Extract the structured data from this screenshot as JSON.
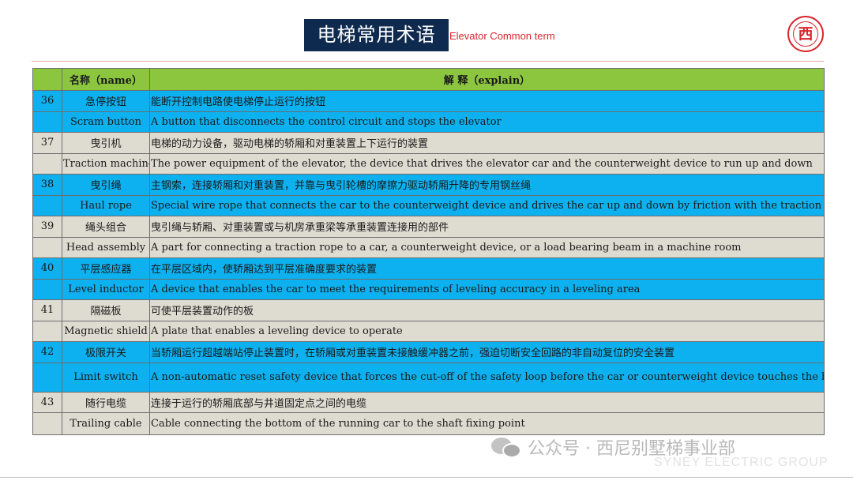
{
  "header": {
    "title": "电梯常用术语",
    "subtitle": "Elevator Common term",
    "logo_text": "西"
  },
  "colors": {
    "title_bg": "#0e2a4f",
    "accent_red": "#d9262c",
    "header_green": "#8cc63f",
    "row_blue": "#0db1ef",
    "row_grey": "#dedbd0"
  },
  "table": {
    "headers": {
      "name": "名称（name）",
      "explain": "解 释（explain）"
    },
    "rows": [
      {
        "num": "36",
        "name": "急停按钮",
        "explain": "能断开控制电路使电梯停止运行的按钮"
      },
      {
        "num": "",
        "name": "Scram button",
        "explain": "A button that disconnects the control circuit and stops the elevator"
      },
      {
        "num": "37",
        "name": "曳引机",
        "explain": "电梯的动力设备，驱动电梯的轿厢和对重装置上下运行的装置"
      },
      {
        "num": "",
        "name": "Traction machine",
        "explain": "The power equipment of the elevator, the device that drives the elevator car and the counterweight device to run up and down"
      },
      {
        "num": "38",
        "name": "曳引绳",
        "explain": "主钢索，连接轿厢和对重装置，并靠与曳引轮槽的摩擦力驱动轿厢升降的专用钢丝绳"
      },
      {
        "num": "",
        "name": "Haul rope",
        "explain": "Special wire rope that connects the car to the counterweight device and drives the car up and down by friction with the traction wheel groove"
      },
      {
        "num": "39",
        "name": "绳头组合",
        "explain": "曳引绳与轿厢、对重装置或与机房承重梁等承重装置连接用的部件"
      },
      {
        "num": "",
        "name": "Head assembly",
        "explain": "A part for connecting a traction rope to a car, a counterweight device, or a load bearing beam in a machine room"
      },
      {
        "num": "40",
        "name": "平层感应器",
        "explain": "在平层区域内，使轿厢达到平层准确度要求的装置"
      },
      {
        "num": "",
        "name": "Level inductor",
        "explain": "A device that enables the car to meet the requirements of leveling accuracy in a leveling area"
      },
      {
        "num": "41",
        "name": "隔磁板",
        "explain": "可使平层装置动作的板"
      },
      {
        "num": "",
        "name": "Magnetic shield",
        "explain": "A plate that enables a leveling device to operate"
      },
      {
        "num": "42",
        "name": "极限开关",
        "explain": "当轿厢运行超越端站停止装置时，在轿厢或对重装置未接触缓冲器之前，强迫切断安全回路的非自动复位的安全装置"
      },
      {
        "num": "",
        "name": "Limit switch",
        "explain": "A non-automatic reset safety device that forces the cut-off of the safety loop before the car or counterweight device touches the buffer when the car runs beyond the terminal stop device"
      },
      {
        "num": "43",
        "name": "随行电缆",
        "explain": "连接于运行的轿厢底部与井道固定点之间的电缆"
      },
      {
        "num": "",
        "name": "Trailing cable",
        "explain": "Cable connecting the bottom of the running car to the shaft fixing point"
      }
    ]
  },
  "watermark": {
    "text": "公众号 · 西尼别墅梯事业部",
    "english": "SYNEY ELECTRIC GROUP",
    "icon": "wechat-icon"
  }
}
